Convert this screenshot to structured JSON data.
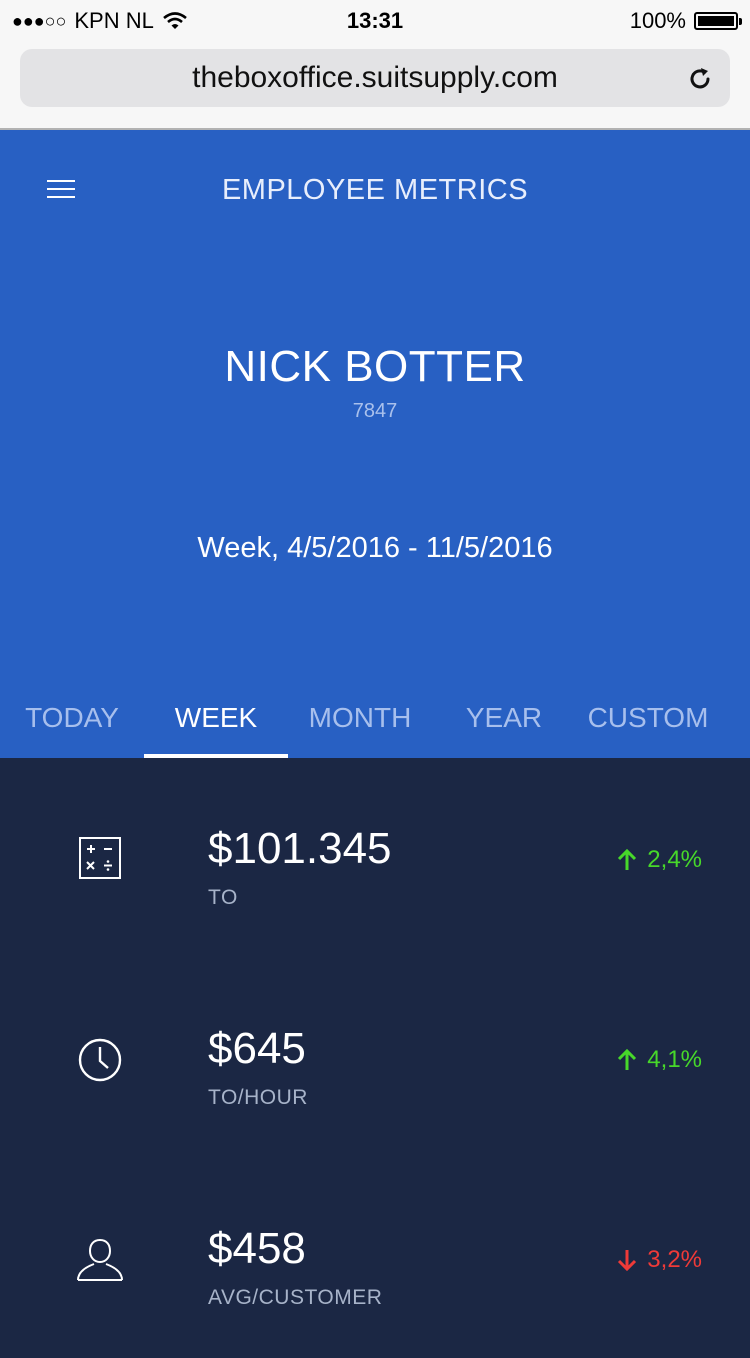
{
  "status_bar": {
    "signal": "●●●○○",
    "carrier": "KPN NL",
    "time": "13:31",
    "battery": "100%"
  },
  "browser": {
    "url": "theboxoffice.suitsupply.com"
  },
  "header": {
    "title": "EMPLOYEE METRICS"
  },
  "employee": {
    "name": "NICK BOTTER",
    "id": "7847"
  },
  "period": "Week, 4/5/2016 - 11/5/2016",
  "tabs": [
    {
      "label": "TODAY",
      "active": false
    },
    {
      "label": "WEEK",
      "active": true
    },
    {
      "label": "MONTH",
      "active": false
    },
    {
      "label": "YEAR",
      "active": false
    },
    {
      "label": "CUSTOM",
      "active": false
    }
  ],
  "metrics": [
    {
      "icon": "calculator-icon",
      "value": "$101.345",
      "label": "TO",
      "change": "2,4%",
      "direction": "up"
    },
    {
      "icon": "clock-icon",
      "value": "$645",
      "label": "TO/HOUR",
      "change": "4,1%",
      "direction": "up"
    },
    {
      "icon": "person-icon",
      "value": "$458",
      "label": "AVG/CUSTOMER",
      "change": "3,2%",
      "direction": "down"
    }
  ],
  "colors": {
    "hero_blue": "#2860c3",
    "dark_navy": "#1b2744",
    "up_green": "#47d82a",
    "down_red": "#ef3a38"
  }
}
